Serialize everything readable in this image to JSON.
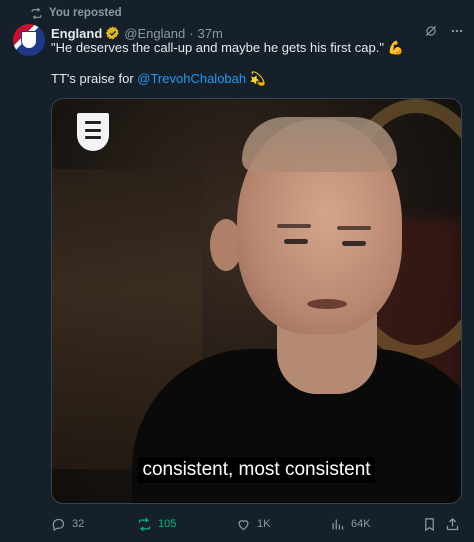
{
  "repost_banner": {
    "text": "You reposted"
  },
  "author": {
    "name": "England",
    "handle": "@England",
    "separator": "·",
    "time": "37m"
  },
  "tweet": {
    "line1": "\"He deserves the call-up and maybe he gets his first cap.\" 💪",
    "line2_prefix": "TT's praise for ",
    "line2_mention": "@TrevohChalobah",
    "line2_suffix": " 💫"
  },
  "media": {
    "caption": "consistent, most consistent"
  },
  "engagement": {
    "replies": "32",
    "reposts": "105",
    "likes": "1K",
    "views": "64K"
  },
  "colors": {
    "background": "#15202b",
    "accent": "#1d9bf0",
    "repost_active": "#00ba7c",
    "muted": "#8b98a5"
  }
}
